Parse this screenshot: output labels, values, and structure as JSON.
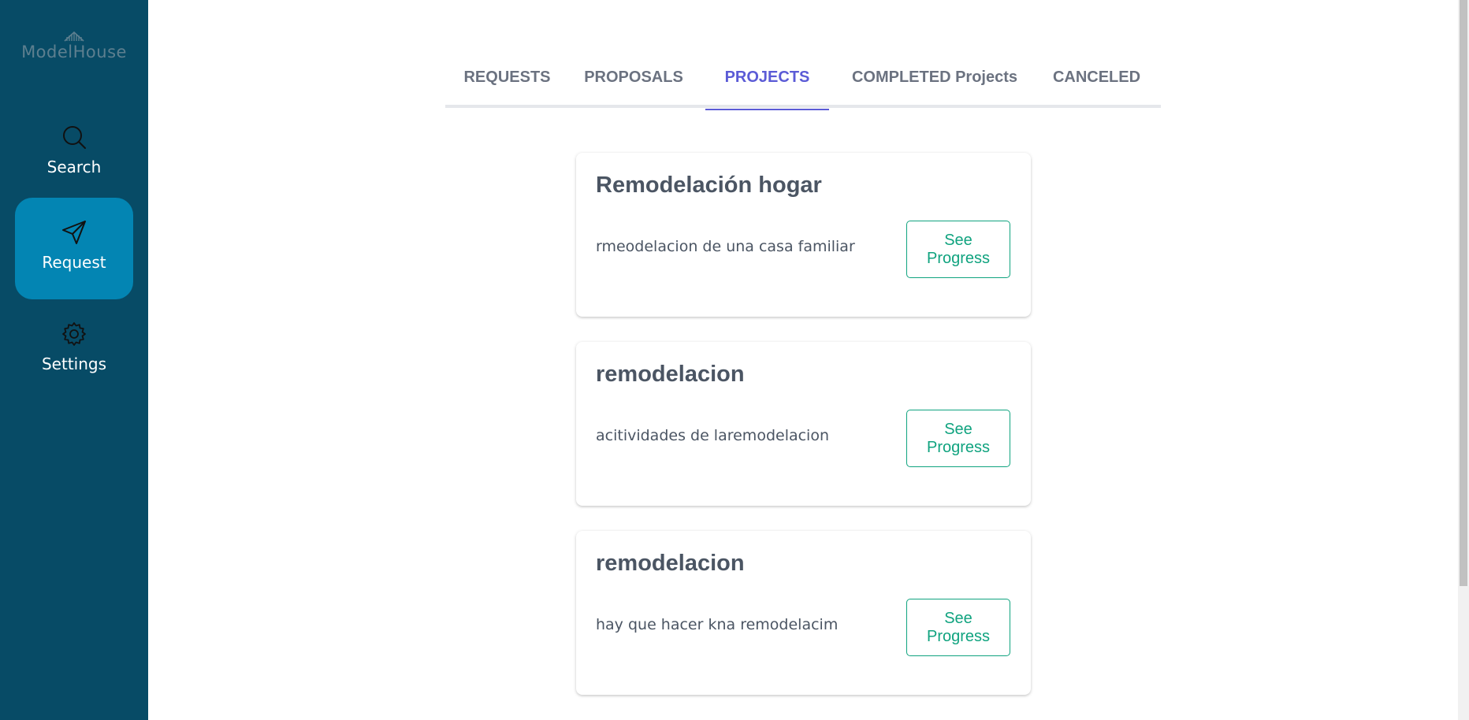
{
  "brand": {
    "name": "ModelHouse"
  },
  "sidebar": {
    "items": [
      {
        "label": "Search",
        "icon": "search-icon"
      },
      {
        "label": "Request",
        "icon": "send-icon",
        "active": true
      },
      {
        "label": "Settings",
        "icon": "gear-icon"
      }
    ]
  },
  "tabs": [
    {
      "label": "REQUESTS"
    },
    {
      "label": "PROPOSALS"
    },
    {
      "label": "PROJECTS",
      "active": true
    },
    {
      "label": "COMPLETED Projects"
    },
    {
      "label": "CANCELED"
    }
  ],
  "projects": [
    {
      "title": "Remodelación hogar",
      "description": "rmeodelacion de una casa familiar",
      "button": "See Progress"
    },
    {
      "title": "remodelacion",
      "description": "acitividades de laremodelacion",
      "button": "See Progress"
    },
    {
      "title": "remodelacion",
      "description": "hay que hacer kna remodelacim",
      "button": "See Progress"
    }
  ],
  "colors": {
    "sidebar_bg": "#074b66",
    "active_nav": "#0385b3",
    "active_tab": "#5b5bd6",
    "button_accent": "#10a37f"
  }
}
